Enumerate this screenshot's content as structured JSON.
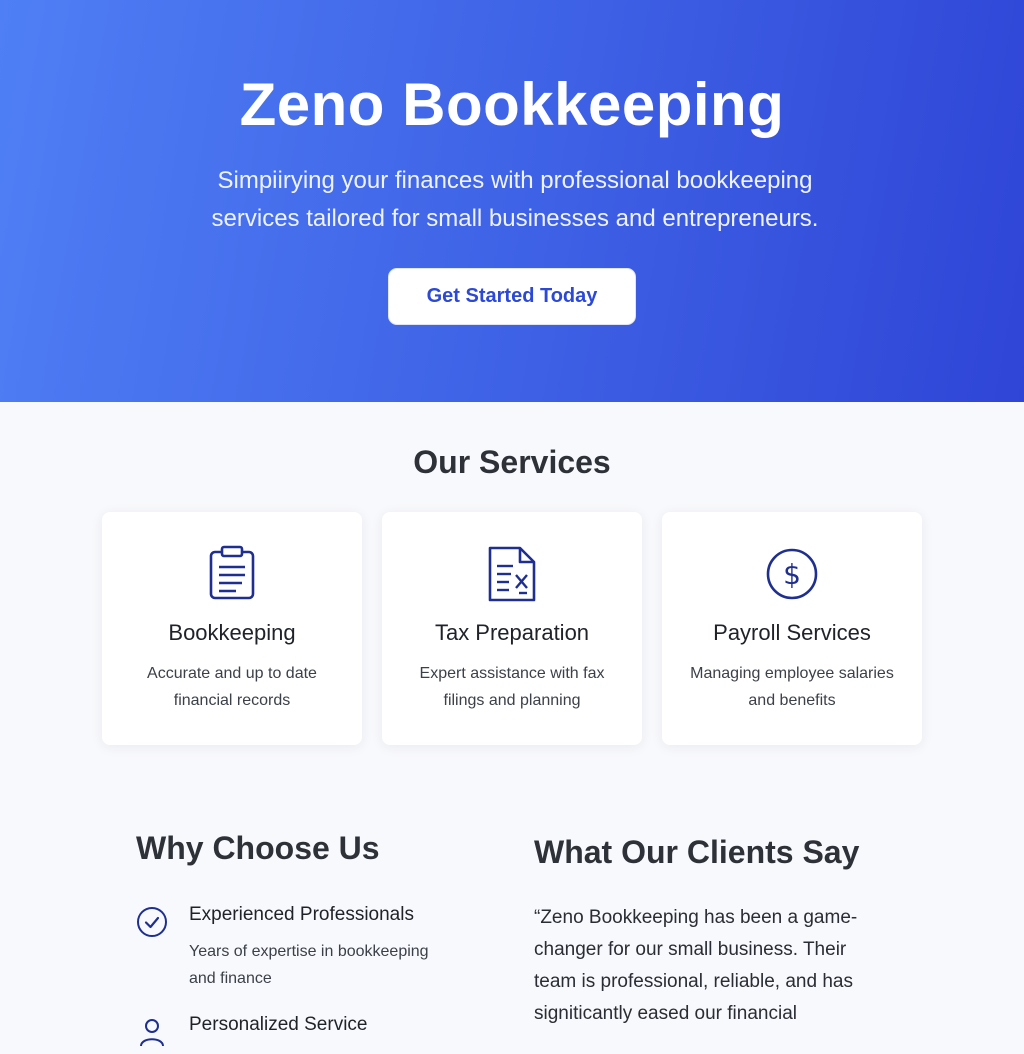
{
  "hero": {
    "title": "Zeno Bookkeeping",
    "subtitle": "Simpiirying your finances with professional bookkeeping services tailored for small businesses and entrepreneurs.",
    "cta_label": "Get Started Today"
  },
  "services": {
    "title": "Our Services",
    "items": [
      {
        "icon": "clipboard-icon",
        "title": "Bookkeeping",
        "desc": "Accurate and up to date financial records"
      },
      {
        "icon": "tax-document-icon",
        "title": "Tax Preparation",
        "desc": "Expert assistance with fax filings and planning"
      },
      {
        "icon": "dollar-circle-icon",
        "title": "Payroll Services",
        "desc": "Managing employee salaries and benefits"
      }
    ]
  },
  "why": {
    "title": "Why Choose Us",
    "items": [
      {
        "icon": "check-circle-icon",
        "title": "Experienced Professionals",
        "desc": "Years of expertise in bookkeeping and finance"
      },
      {
        "icon": "person-icon",
        "title": "Personalized Service",
        "desc": ""
      }
    ]
  },
  "testimonials": {
    "title": "What Our Clients Say",
    "quote": "“Zeno Bookkeeping has been a game-changer for our small business. Their team is professional, reliable, and has signiticantly eased our financial"
  },
  "colors": {
    "accent": "#2b49d6",
    "icon": "#1f2f8f",
    "hero_start": "#4f7ff5",
    "hero_end": "#2f45d6"
  }
}
